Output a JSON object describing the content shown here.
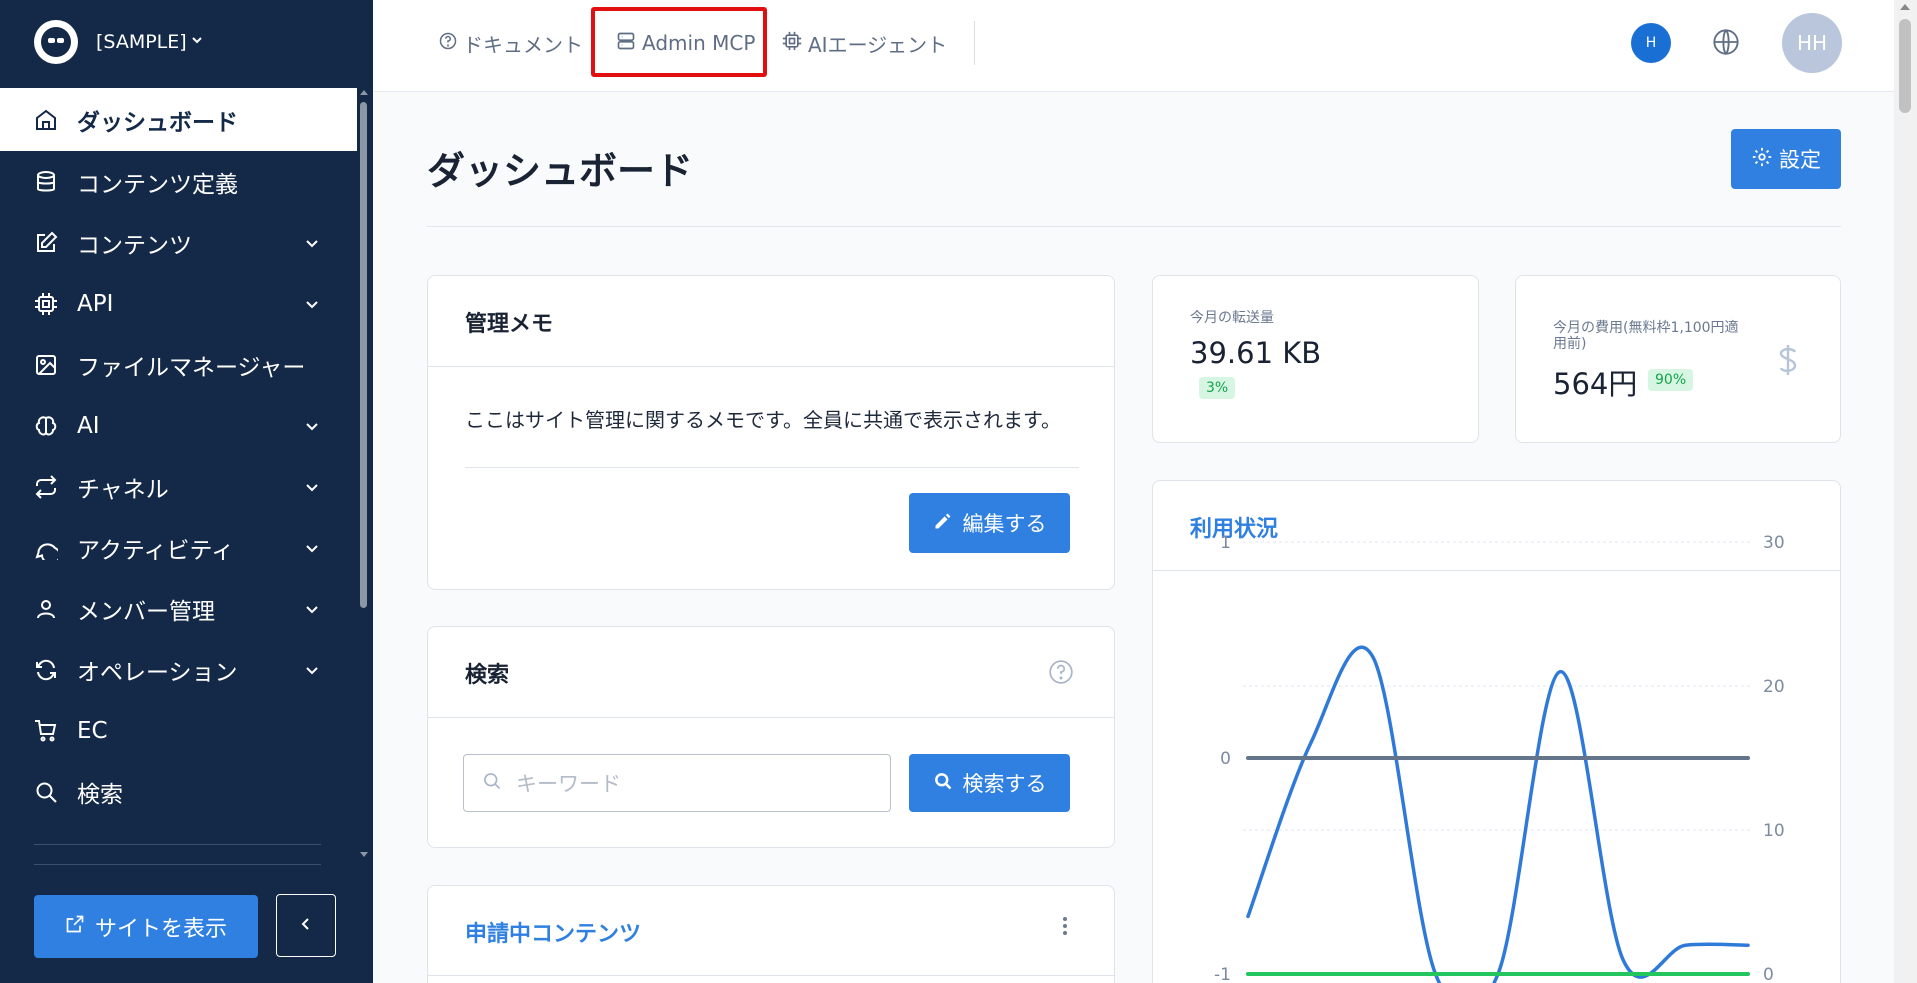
{
  "sidebar": {
    "site_name": "[SAMPLE]",
    "items": [
      {
        "label": "ダッシュボード",
        "icon": "home-icon",
        "active": true
      },
      {
        "label": "コンテンツ定義",
        "icon": "database-icon"
      },
      {
        "label": "コンテンツ",
        "icon": "edit-icon",
        "has_children": true
      },
      {
        "label": "API",
        "icon": "cpu-icon",
        "has_children": true
      },
      {
        "label": "ファイルマネージャー",
        "icon": "image-icon"
      },
      {
        "label": "AI",
        "icon": "brain-icon",
        "has_children": true
      },
      {
        "label": "チャネル",
        "icon": "repeat-icon",
        "has_children": true
      },
      {
        "label": "アクティビティ",
        "icon": "chat-icon",
        "has_children": true
      },
      {
        "label": "メンバー管理",
        "icon": "user-icon",
        "has_children": true
      },
      {
        "label": "オペレーション",
        "icon": "refresh-icon",
        "has_children": true
      },
      {
        "label": "EC",
        "icon": "cart-icon"
      },
      {
        "label": "検索",
        "icon": "search-icon"
      }
    ],
    "view_site_label": "サイトを表示"
  },
  "topbar": {
    "links": [
      {
        "label": "ドキュメント",
        "icon": "help-circle-icon"
      },
      {
        "label": "Admin MCP",
        "icon": "server-icon"
      },
      {
        "label": "AIエージェント",
        "icon": "cpu-icon"
      }
    ],
    "user_badge": "H",
    "avatar_initials": "HH"
  },
  "page": {
    "title": "ダッシュボード",
    "settings_label": "設定"
  },
  "memo": {
    "title": "管理メモ",
    "text": "ここはサイト管理に関するメモです。全員に共通で表示されます。",
    "edit_label": "編集する"
  },
  "search": {
    "title": "検索",
    "placeholder": "キーワード",
    "button_label": "検索する"
  },
  "pending": {
    "title": "申請中コンテンツ"
  },
  "stats": {
    "transfer_label": "今月の転送量",
    "transfer_value": "39.61 KB",
    "transfer_badge": "3%",
    "cost_label_1": "今月の費用(無料枠1,100円適",
    "cost_label_2": "用前)",
    "cost_value": "564円",
    "cost_badge": "90%"
  },
  "usage": {
    "title": "利用状況"
  },
  "chart_data": {
    "type": "line",
    "left_axis": {
      "ticks": [
        "1",
        "0",
        "-1"
      ],
      "ylim": [
        -1,
        1
      ]
    },
    "right_axis": {
      "ticks": [
        "30",
        "20",
        "10",
        "0"
      ],
      "ylim": [
        0,
        30
      ]
    },
    "x": [
      0,
      1,
      2,
      3,
      4,
      5,
      6,
      7,
      8
    ],
    "series": [
      {
        "color": "#2f7ad9",
        "axis": "right",
        "values": [
          4,
          16,
          22,
          0,
          0,
          21,
          1,
          2,
          2
        ]
      },
      {
        "color": "#64748b",
        "axis": "left",
        "values": [
          0,
          0,
          0,
          0,
          0,
          0,
          0,
          0,
          0
        ]
      },
      {
        "color": "#22c55e",
        "axis": "right",
        "values": [
          0,
          0,
          0,
          0,
          0,
          0,
          0,
          0,
          0
        ]
      }
    ],
    "grid": true
  }
}
